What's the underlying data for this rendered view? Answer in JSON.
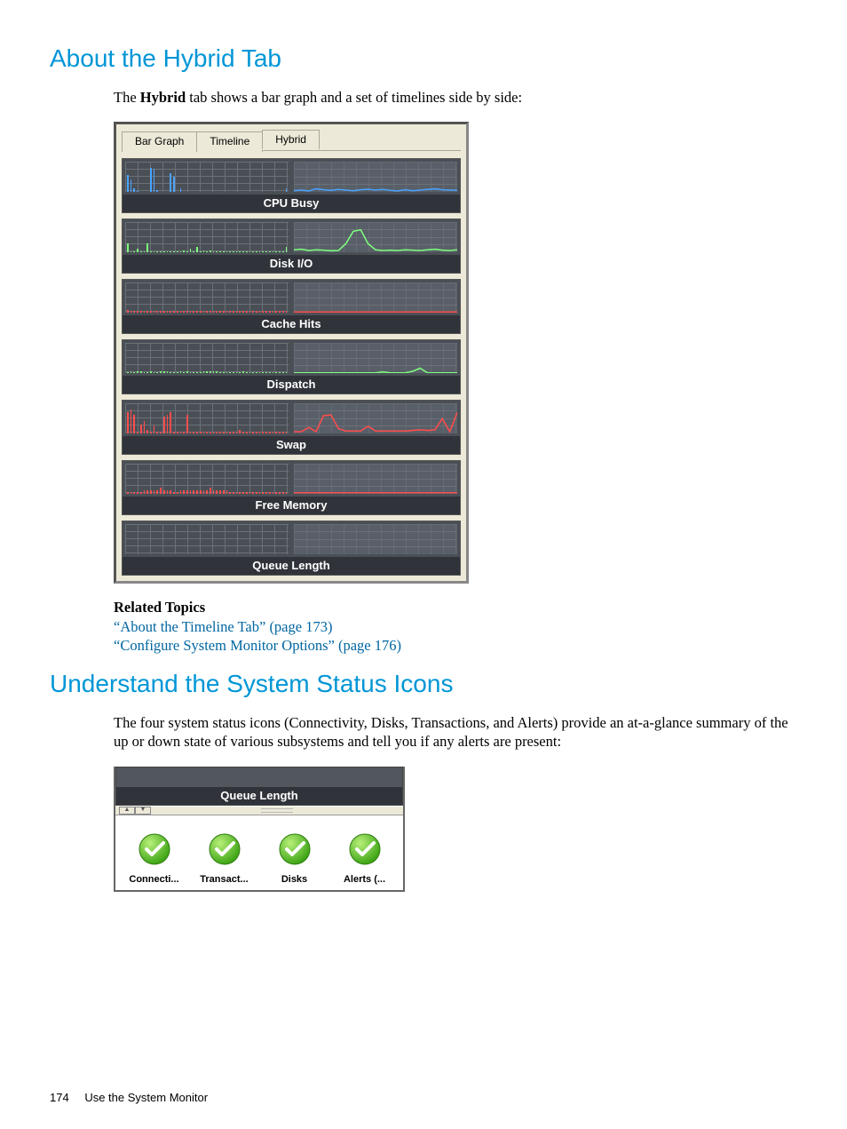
{
  "headings": {
    "h1": "About the Hybrid Tab",
    "h2": "Understand the System Status Icons"
  },
  "paragraphs": {
    "p1a": "The ",
    "p1b": "Hybrid",
    "p1c": " tab shows a bar graph and a set of timelines side by side:",
    "related_head": "Related Topics",
    "link1": "“About the Timeline Tab” (page 173)",
    "link2": "“Configure System Monitor Options” (page 176)",
    "p2": "The four system status icons (Connectivity, Disks, Transactions, and Alerts) provide an at-a-glance summary of the up or down state of various subsystems and tell you if any alerts are present:"
  },
  "fig1": {
    "tabs": {
      "bar": "Bar Graph",
      "timeline": "Timeline",
      "hybrid": "Hybrid"
    },
    "metrics": [
      "CPU Busy",
      "Disk I/O",
      "Cache Hits",
      "Dispatch",
      "Swap",
      "Free Memory",
      "Queue Length"
    ]
  },
  "chart_data": [
    {
      "type": "bar",
      "title": "CPU Busy",
      "bars_pct": [
        55,
        40,
        10,
        2,
        0,
        0,
        0,
        80,
        75,
        5,
        0,
        0,
        0,
        60,
        50,
        0,
        10,
        0,
        0,
        0,
        0,
        0,
        0,
        0,
        0,
        0,
        0,
        0,
        0,
        0,
        0,
        0,
        0,
        0,
        0,
        0,
        0,
        0,
        0,
        0,
        0,
        0,
        0,
        0,
        0,
        0,
        0,
        0,
        10
      ],
      "line_series_color": "blue",
      "line_points": [
        6,
        8,
        5,
        12,
        9,
        7,
        10,
        8,
        6,
        9,
        11,
        8,
        10,
        7,
        5,
        9,
        6,
        8,
        10,
        12,
        9,
        8,
        7
      ]
    },
    {
      "type": "bar",
      "title": "Disk I/O",
      "bars_pct": [
        30,
        2,
        2,
        10,
        2,
        2,
        30,
        2,
        2,
        2,
        2,
        2,
        2,
        2,
        2,
        2,
        2,
        4,
        2,
        10,
        2,
        18,
        2,
        4,
        2,
        4,
        2,
        2,
        2,
        2,
        2,
        2,
        2,
        2,
        2,
        2,
        2,
        2,
        2,
        2,
        2,
        2,
        2,
        2,
        2,
        2,
        2,
        2,
        18
      ],
      "line_series_color": "green",
      "line_points": [
        10,
        12,
        8,
        10,
        9,
        7,
        8,
        30,
        70,
        75,
        30,
        10,
        8,
        9,
        8,
        10,
        9,
        8,
        10,
        12,
        9,
        8,
        10
      ]
    },
    {
      "type": "bar",
      "title": "Cache Hits",
      "bars_pct": [
        8,
        4,
        4,
        4,
        4,
        4,
        4,
        4,
        4,
        6,
        4,
        4,
        4,
        4,
        4,
        4,
        4,
        4,
        4,
        4,
        4,
        4,
        4,
        6,
        4,
        6,
        4,
        4,
        4,
        4,
        4,
        4,
        4,
        4,
        4,
        4,
        4,
        4,
        4,
        4,
        4,
        4,
        4,
        4,
        4,
        4,
        4,
        4,
        4
      ],
      "line_series_color": "red",
      "line_points": [
        4,
        4,
        4,
        4,
        4,
        4,
        4,
        4,
        4,
        4,
        4,
        4,
        4,
        4,
        4,
        4,
        4,
        4,
        4,
        4,
        4,
        4,
        4
      ]
    },
    {
      "type": "bar",
      "title": "Dispatch",
      "bars_pct": [
        2,
        4,
        2,
        4,
        4,
        2,
        2,
        4,
        2,
        2,
        4,
        4,
        4,
        2,
        2,
        2,
        4,
        2,
        4,
        2,
        2,
        2,
        2,
        4,
        4,
        4,
        4,
        4,
        2,
        2,
        2,
        2,
        2,
        2,
        2,
        4,
        2,
        2,
        2,
        2,
        2,
        2,
        2,
        2,
        2,
        2,
        2,
        2,
        2
      ],
      "line_series_color": "green",
      "line_points": [
        3,
        3,
        3,
        3,
        3,
        3,
        3,
        3,
        3,
        3,
        3,
        3,
        6,
        3,
        3,
        3,
        8,
        18,
        3,
        3,
        3,
        3,
        3
      ]
    },
    {
      "type": "bar",
      "title": "Swap",
      "bars_pct": [
        70,
        80,
        60,
        5,
        30,
        40,
        10,
        5,
        25,
        5,
        5,
        55,
        60,
        70,
        5,
        5,
        5,
        5,
        60,
        5,
        5,
        5,
        5,
        5,
        5,
        5,
        5,
        5,
        5,
        5,
        5,
        5,
        5,
        5,
        10,
        5,
        5,
        5,
        5,
        5,
        5,
        5,
        5,
        5,
        5,
        5,
        5,
        5,
        5
      ],
      "line_series_color": "red",
      "line_points": [
        8,
        8,
        22,
        8,
        60,
        62,
        18,
        10,
        10,
        10,
        26,
        10,
        10,
        10,
        10,
        10,
        12,
        14,
        12,
        14,
        50,
        8,
        70
      ]
    },
    {
      "type": "bar",
      "title": "Free Memory",
      "bars_pct": [
        4,
        6,
        4,
        6,
        4,
        12,
        10,
        12,
        12,
        12,
        20,
        12,
        12,
        10,
        4,
        4,
        10,
        12,
        12,
        12,
        12,
        12,
        12,
        12,
        12,
        20,
        12,
        12,
        12,
        12,
        12,
        4,
        4,
        4,
        4,
        4,
        4,
        4,
        4,
        4,
        4,
        4,
        4,
        4,
        4,
        4,
        4,
        4,
        4
      ],
      "line_series_color": "red",
      "line_points": [
        6,
        6,
        6,
        6,
        6,
        6,
        6,
        6,
        6,
        6,
        6,
        6,
        6,
        6,
        6,
        6,
        6,
        6,
        6,
        6,
        6,
        6,
        6
      ]
    },
    {
      "type": "bar",
      "title": "Queue Length",
      "bars_pct": [
        0,
        0,
        0,
        0,
        0,
        0,
        0,
        0,
        0,
        0,
        0,
        0,
        0,
        0,
        0,
        0,
        0,
        0,
        0,
        0,
        0,
        0,
        0,
        0,
        0,
        0,
        0,
        0,
        0,
        0,
        0,
        0,
        0,
        0,
        0,
        0,
        0,
        0,
        0,
        0,
        0,
        0,
        0,
        0,
        0,
        0,
        0,
        0,
        0
      ],
      "line_series_color": "none",
      "line_points": [
        0,
        0,
        0,
        0,
        0,
        0,
        0,
        0,
        0,
        0,
        0,
        0,
        0,
        0,
        0,
        0,
        0,
        0,
        0,
        0,
        0,
        0,
        0
      ]
    }
  ],
  "fig2": {
    "queue_label": "Queue Length",
    "icons": [
      {
        "label": "Connecti...",
        "status": "ok"
      },
      {
        "label": "Transact...",
        "status": "ok"
      },
      {
        "label": "Disks",
        "status": "ok"
      },
      {
        "label": "Alerts (...",
        "status": "ok"
      }
    ]
  },
  "footer": {
    "page": "174",
    "chapter": "Use the System Monitor"
  }
}
